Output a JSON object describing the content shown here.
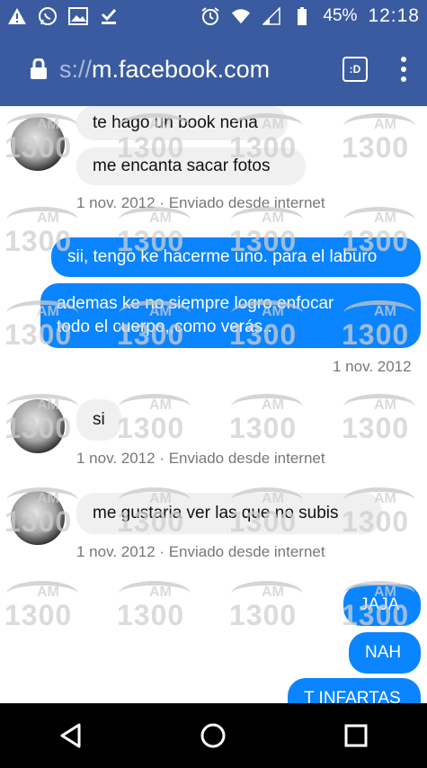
{
  "status_bar": {
    "battery_pct": "45%",
    "clock": "12:18",
    "left_icons": [
      "warning-icon",
      "whatsapp-icon",
      "gallery-icon",
      "download-done-icon"
    ],
    "right_icons": [
      "alarm-icon",
      "wifi-icon",
      "signal-icon",
      "battery-icon"
    ]
  },
  "url_bar": {
    "scheme": "s://",
    "host": "m.facebook.com",
    "tabs_label": ":D"
  },
  "messages": [
    {
      "dir": "in",
      "text": "te hago un book nena"
    },
    {
      "dir": "in",
      "text": "me encanta sacar fotos"
    },
    {
      "meta": "1 nov. 2012 · Enviado desde internet"
    },
    {
      "dir": "out",
      "text": "sii, tengo ke hacerme uno. para el laburo"
    },
    {
      "dir": "out",
      "lines": [
        "ademas ke no siempre logro enfocar",
        "todo el cuerpo,,como verás.."
      ]
    },
    {
      "meta": "1 nov. 2012"
    },
    {
      "dir": "in",
      "text": "si"
    },
    {
      "meta": "1 nov. 2012 · Enviado desde internet"
    },
    {
      "dir": "in",
      "text": "me gustaria ver  las que no subis"
    },
    {
      "meta": "1 nov. 2012 · Enviado desde internet"
    },
    {
      "dir": "out",
      "text": "JAJA"
    },
    {
      "dir": "out",
      "text": "NAH"
    },
    {
      "dir": "out",
      "text": "T INFARTAS"
    }
  ],
  "watermark": {
    "brand": "AM",
    "number": "1300"
  },
  "colors": {
    "header": "#3b5ba0",
    "outgoing": "#0a84ff",
    "incoming": "#f0f0f0"
  }
}
